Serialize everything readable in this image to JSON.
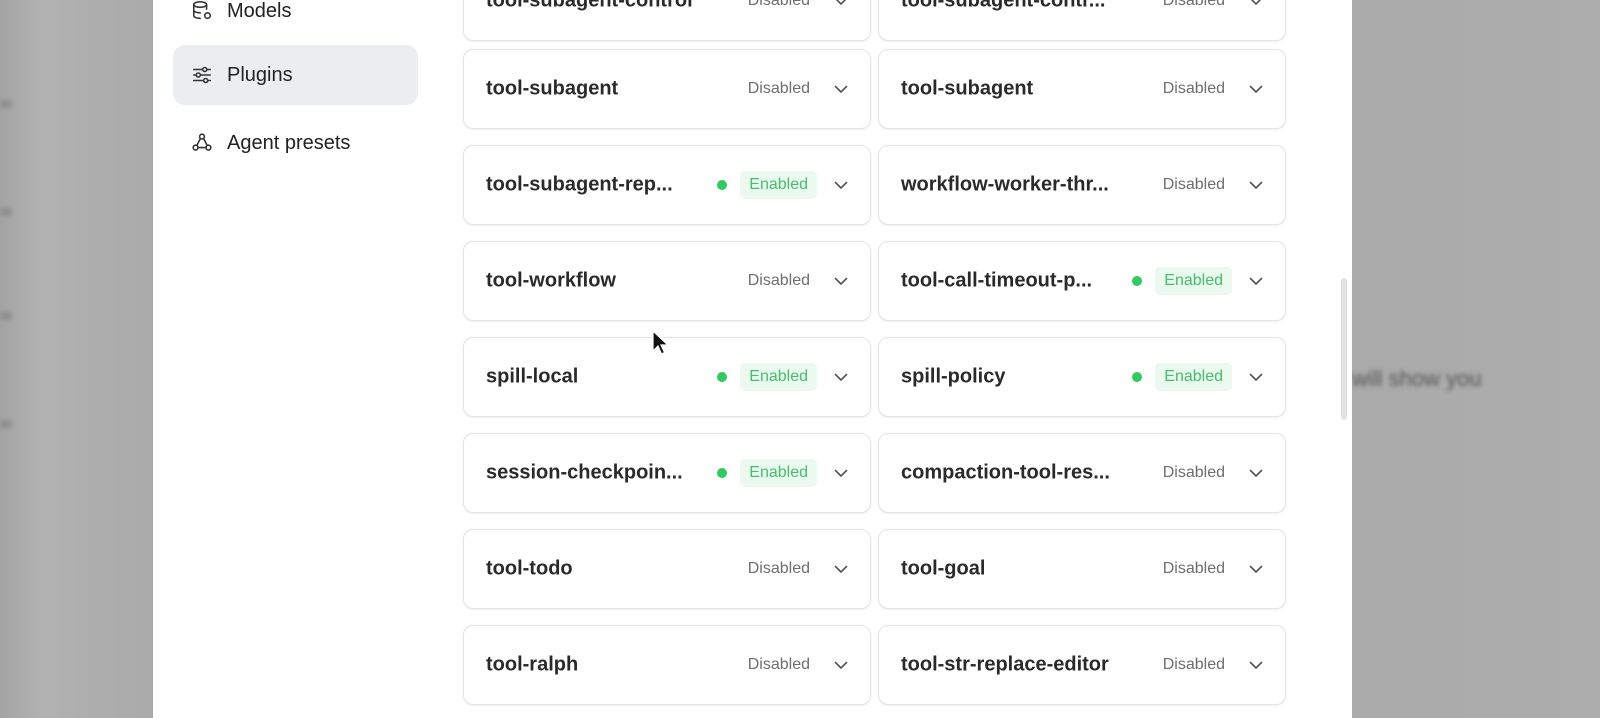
{
  "sidebar": {
    "items": [
      {
        "label": "Models",
        "icon": "database-gear-icon",
        "active": false
      },
      {
        "label": "Plugins",
        "icon": "sliders-icon",
        "active": true
      },
      {
        "label": "Agent presets",
        "icon": "agents-icon",
        "active": false
      }
    ]
  },
  "plugins": [
    {
      "name": "tool-subagent-control",
      "status": "Disabled"
    },
    {
      "name": "tool-subagent-contr...",
      "status": "Disabled"
    },
    {
      "name": "tool-subagent",
      "status": "Disabled"
    },
    {
      "name": "tool-subagent",
      "status": "Disabled"
    },
    {
      "name": "tool-subagent-rep...",
      "status": "Enabled"
    },
    {
      "name": "workflow-worker-thr...",
      "status": "Disabled"
    },
    {
      "name": "tool-workflow",
      "status": "Disabled"
    },
    {
      "name": "tool-call-timeout-p...",
      "status": "Enabled"
    },
    {
      "name": "spill-local",
      "status": "Enabled"
    },
    {
      "name": "spill-policy",
      "status": "Enabled"
    },
    {
      "name": "session-checkpoin...",
      "status": "Enabled"
    },
    {
      "name": "compaction-tool-res...",
      "status": "Disabled"
    },
    {
      "name": "tool-todo",
      "status": "Disabled"
    },
    {
      "name": "tool-goal",
      "status": "Disabled"
    },
    {
      "name": "tool-ralph",
      "status": "Disabled"
    },
    {
      "name": "tool-str-replace-editor",
      "status": "Disabled"
    }
  ],
  "background": {
    "right_text": "will show you"
  },
  "colors": {
    "enabled_text": "#43c16a",
    "enabled_dot": "#2ecc5e",
    "active_nav": "#ebeef1"
  }
}
